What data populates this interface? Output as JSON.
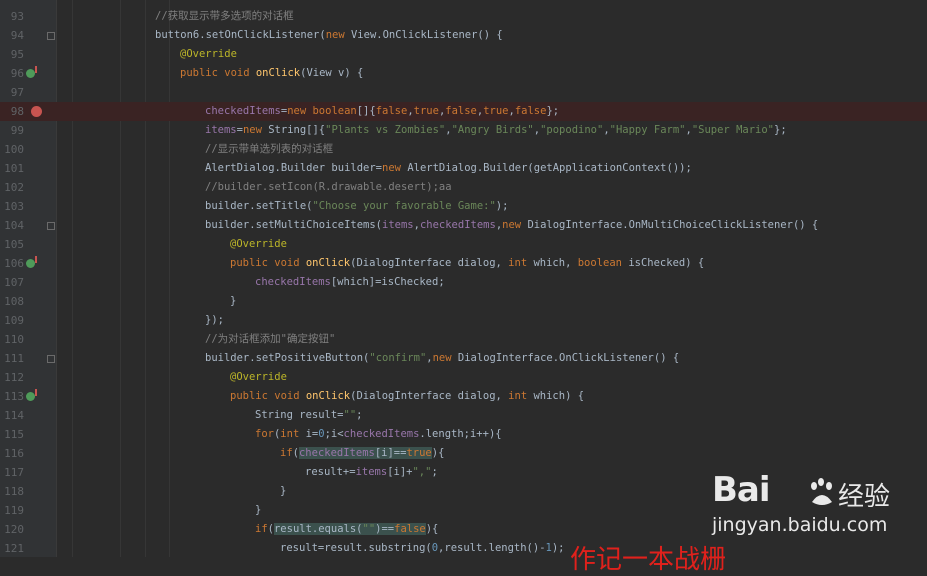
{
  "editor": {
    "lines": [
      {
        "num": "93",
        "indent": 4,
        "tokens": [
          {
            "t": "//获取显示带多选项的对话框",
            "c": "cm"
          }
        ]
      },
      {
        "num": "94",
        "indent": 4,
        "tokens": [
          {
            "t": "button6.setOnClickListener("
          },
          {
            "t": "new ",
            "c": "kw"
          },
          {
            "t": "View.OnClickListener() {"
          }
        ]
      },
      {
        "num": "95",
        "indent": 6,
        "tokens": [
          {
            "t": "@Override",
            "c": "an"
          }
        ]
      },
      {
        "num": "96",
        "indent": 6,
        "tokens": [
          {
            "t": "public void ",
            "c": "kw"
          },
          {
            "t": "onClick",
            "c": "fn"
          },
          {
            "t": "(View v) {"
          }
        ]
      },
      {
        "num": "97",
        "indent": 0,
        "tokens": []
      },
      {
        "num": "98",
        "indent": 8,
        "breakpoint": true,
        "tokens": [
          {
            "t": "checkedItems",
            "c": "fd"
          },
          {
            "t": "="
          },
          {
            "t": "new boolean",
            "c": "kw"
          },
          {
            "t": "[]{"
          },
          {
            "t": "false",
            "c": "kw"
          },
          {
            "t": ","
          },
          {
            "t": "true",
            "c": "kw"
          },
          {
            "t": ","
          },
          {
            "t": "false",
            "c": "kw"
          },
          {
            "t": ","
          },
          {
            "t": "true",
            "c": "kw"
          },
          {
            "t": ","
          },
          {
            "t": "false",
            "c": "kw"
          },
          {
            "t": "};"
          }
        ]
      },
      {
        "num": "99",
        "indent": 8,
        "tokens": [
          {
            "t": "items",
            "c": "fd"
          },
          {
            "t": "="
          },
          {
            "t": "new ",
            "c": "kw"
          },
          {
            "t": "String[]{"
          },
          {
            "t": "\"Plants vs Zombies\"",
            "c": "st"
          },
          {
            "t": ","
          },
          {
            "t": "\"Angry Birds\"",
            "c": "st"
          },
          {
            "t": ","
          },
          {
            "t": "\"popodino\"",
            "c": "st"
          },
          {
            "t": ","
          },
          {
            "t": "\"Happy Farm\"",
            "c": "st"
          },
          {
            "t": ","
          },
          {
            "t": "\"Super Mario\"",
            "c": "st"
          },
          {
            "t": "};"
          }
        ]
      },
      {
        "num": "100",
        "indent": 8,
        "tokens": [
          {
            "t": "//显示带单选列表的对话框",
            "c": "cm"
          }
        ]
      },
      {
        "num": "101",
        "indent": 8,
        "tokens": [
          {
            "t": "AlertDialog.Builder builder="
          },
          {
            "t": "new ",
            "c": "kw"
          },
          {
            "t": "AlertDialog.Builder(getApplicationContext());"
          }
        ]
      },
      {
        "num": "102",
        "indent": 8,
        "tokens": [
          {
            "t": "//builder.setIcon(R.drawable.desert);aa",
            "c": "cm"
          }
        ]
      },
      {
        "num": "103",
        "indent": 8,
        "tokens": [
          {
            "t": "builder.setTitle("
          },
          {
            "t": "\"Choose your favorable Game:\"",
            "c": "st"
          },
          {
            "t": ");"
          }
        ]
      },
      {
        "num": "104",
        "indent": 8,
        "tokens": [
          {
            "t": "builder.setMultiChoiceItems("
          },
          {
            "t": "items",
            "c": "fd"
          },
          {
            "t": ","
          },
          {
            "t": "checkedItems",
            "c": "fd"
          },
          {
            "t": ","
          },
          {
            "t": "new ",
            "c": "kw"
          },
          {
            "t": "DialogInterface.OnMultiChoiceClickListener() {"
          }
        ]
      },
      {
        "num": "105",
        "indent": 10,
        "tokens": [
          {
            "t": "@Override",
            "c": "an"
          }
        ]
      },
      {
        "num": "106",
        "indent": 10,
        "tokens": [
          {
            "t": "public void ",
            "c": "kw"
          },
          {
            "t": "onClick",
            "c": "fn"
          },
          {
            "t": "(DialogInterface dialog, "
          },
          {
            "t": "int ",
            "c": "kw"
          },
          {
            "t": "which, "
          },
          {
            "t": "boolean ",
            "c": "kw"
          },
          {
            "t": "isChecked) {"
          }
        ]
      },
      {
        "num": "107",
        "indent": 12,
        "tokens": [
          {
            "t": "checkedItems",
            "c": "fd"
          },
          {
            "t": "[which]=isChecked;"
          }
        ]
      },
      {
        "num": "108",
        "indent": 10,
        "tokens": [
          {
            "t": "}"
          }
        ]
      },
      {
        "num": "109",
        "indent": 8,
        "tokens": [
          {
            "t": "});"
          }
        ]
      },
      {
        "num": "110",
        "indent": 8,
        "tokens": [
          {
            "t": "//为对话框添加\"确定按钮\"",
            "c": "cm"
          }
        ]
      },
      {
        "num": "111",
        "indent": 8,
        "tokens": [
          {
            "t": "builder.setPositiveButton("
          },
          {
            "t": "\"confirm\"",
            "c": "st"
          },
          {
            "t": ","
          },
          {
            "t": "new ",
            "c": "kw"
          },
          {
            "t": "DialogInterface.OnClickListener() {"
          }
        ]
      },
      {
        "num": "112",
        "indent": 10,
        "tokens": [
          {
            "t": "@Override",
            "c": "an"
          }
        ]
      },
      {
        "num": "113",
        "indent": 10,
        "tokens": [
          {
            "t": "public void ",
            "c": "kw"
          },
          {
            "t": "onClick",
            "c": "fn"
          },
          {
            "t": "(DialogInterface dialog, "
          },
          {
            "t": "int ",
            "c": "kw"
          },
          {
            "t": "which) {"
          }
        ]
      },
      {
        "num": "114",
        "indent": 12,
        "tokens": [
          {
            "t": "String result="
          },
          {
            "t": "\"\"",
            "c": "st"
          },
          {
            "t": ";"
          }
        ]
      },
      {
        "num": "115",
        "indent": 12,
        "tokens": [
          {
            "t": "for",
            "c": "kw"
          },
          {
            "t": "("
          },
          {
            "t": "int ",
            "c": "kw"
          },
          {
            "t": "i="
          },
          {
            "t": "0",
            "c": "nm"
          },
          {
            "t": ";i<"
          },
          {
            "t": "checkedItems",
            "c": "fd"
          },
          {
            "t": ".length;i++){"
          }
        ]
      },
      {
        "num": "116",
        "indent": 14,
        "tokens": [
          {
            "t": "if",
            "c": "kw"
          },
          {
            "t": "("
          },
          {
            "t": "checkedItems",
            "c": "fd",
            "h": true
          },
          {
            "t": "[i]==",
            "h": true
          },
          {
            "t": "true",
            "c": "kw",
            "h": true
          },
          {
            "t": "){"
          }
        ]
      },
      {
        "num": "117",
        "indent": 16,
        "tokens": [
          {
            "t": "result+="
          },
          {
            "t": "items",
            "c": "fd"
          },
          {
            "t": "[i]+"
          },
          {
            "t": "\",\"",
            "c": "st"
          },
          {
            "t": ";"
          }
        ]
      },
      {
        "num": "118",
        "indent": 14,
        "tokens": [
          {
            "t": "}"
          }
        ]
      },
      {
        "num": "119",
        "indent": 12,
        "tokens": [
          {
            "t": "}"
          }
        ]
      },
      {
        "num": "120",
        "indent": 12,
        "tokens": [
          {
            "t": "if",
            "c": "kw"
          },
          {
            "t": "("
          },
          {
            "t": "result.equals(",
            "h": true
          },
          {
            "t": "\"\"",
            "c": "st",
            "h": true
          },
          {
            "t": ")==",
            "h": true
          },
          {
            "t": "false",
            "c": "kw",
            "h": true
          },
          {
            "t": "){"
          }
        ]
      },
      {
        "num": "121",
        "indent": 14,
        "tokens": [
          {
            "t": "result=result.substring("
          },
          {
            "t": "0",
            "c": "nm"
          },
          {
            "t": ",result.length()-"
          },
          {
            "t": "1",
            "c": "nm"
          },
          {
            "t": ");"
          }
        ]
      }
    ]
  },
  "watermark": {
    "brand_left": "Bai",
    "brand_right": "经验",
    "url": "jingyan.baidu.com"
  },
  "overlay_text": "作记一本战栅"
}
